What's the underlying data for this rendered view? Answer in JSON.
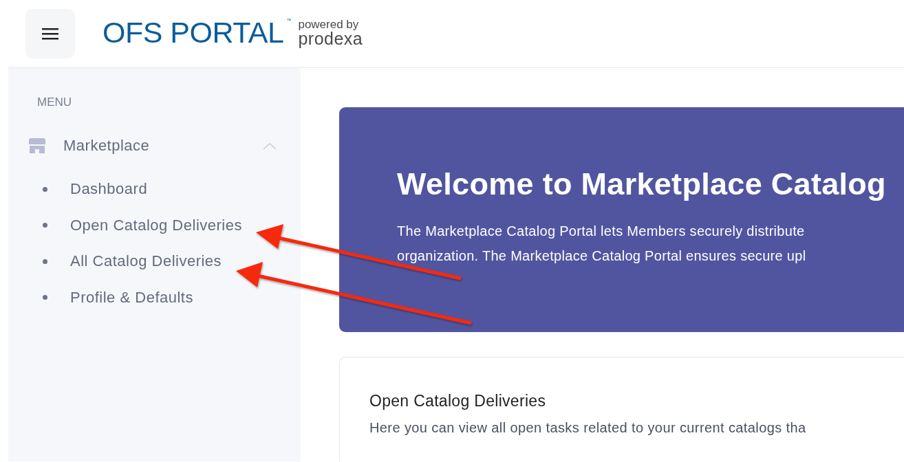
{
  "header": {
    "logo": {
      "name": "OFS PORTAL",
      "trademark": "™",
      "powered_by": "powered by",
      "vendor": "prodexa"
    }
  },
  "sidebar": {
    "heading": "MENU",
    "groups": [
      {
        "label": "Marketplace",
        "expanded": true,
        "items": [
          {
            "label": "Dashboard"
          },
          {
            "label": "Open Catalog Deliveries"
          },
          {
            "label": "All Catalog Deliveries"
          },
          {
            "label": "Profile & Defaults"
          }
        ]
      }
    ]
  },
  "hero": {
    "title": "Welcome to Marketplace Catalog",
    "lines": [
      "The Marketplace Catalog Portal lets Members securely distribute",
      "organization. The Marketplace Catalog Portal ensures secure upl"
    ]
  },
  "card": {
    "title": "Open Catalog Deliveries",
    "description": "Here you can view all open tasks related to your current catalogs tha"
  }
}
